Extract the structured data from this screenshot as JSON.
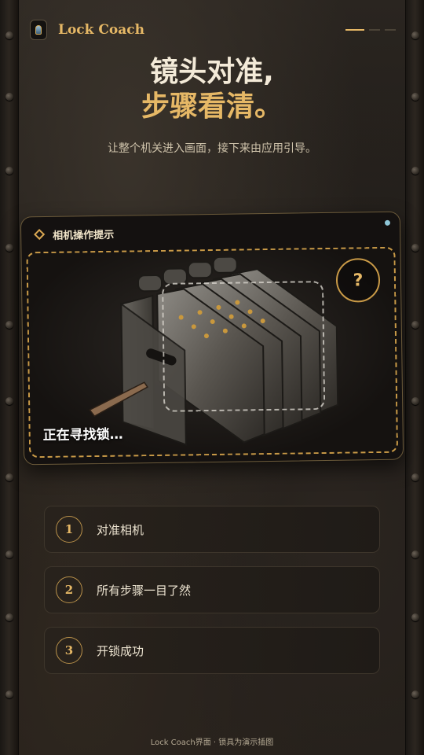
{
  "header": {
    "brand": "Lock Coach",
    "logo_icon": "lantern-icon",
    "progress_steps": 3,
    "progress_active": 1
  },
  "hero": {
    "title_line1": "镜头对准,",
    "title_line2": "步骤看清。",
    "subtitle": "让整个机关进入画面，接下来由应用引导。"
  },
  "camera_card": {
    "title": "相机操作提示",
    "help_label": "?",
    "scan_status": "正在寻找锁…",
    "icons": {
      "title": "diamond-icon",
      "help": "question-icon"
    }
  },
  "steps": [
    {
      "number": "1",
      "label": "对准相机"
    },
    {
      "number": "2",
      "label": "所有步骤一目了然"
    },
    {
      "number": "3",
      "label": "开锁成功"
    }
  ],
  "footer": {
    "caption": "Lock Coach界面 · 锁具为演示插图"
  },
  "colors": {
    "accent": "#e6b866",
    "background": "#1e1a16",
    "text": "#f3ead8"
  }
}
